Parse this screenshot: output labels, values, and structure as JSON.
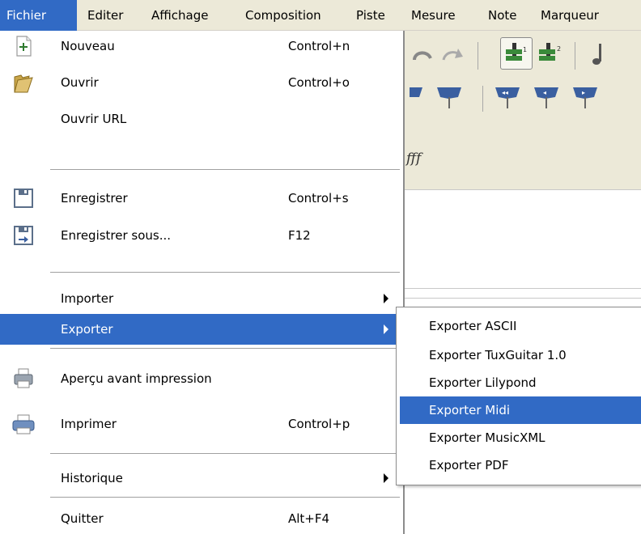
{
  "menubar": {
    "items": [
      {
        "label": "Fichier"
      },
      {
        "label": "Editer"
      },
      {
        "label": "Affichage"
      },
      {
        "label": "Composition"
      },
      {
        "label": "Piste"
      },
      {
        "label": "Mesure"
      },
      {
        "label": "Note"
      },
      {
        "label": "Marqueur"
      }
    ]
  },
  "toolbar": {
    "dynamics_text": "fff"
  },
  "file_menu": {
    "items": [
      {
        "label": "Nouveau",
        "shortcut": "Control+n",
        "icon": "new-file-icon"
      },
      {
        "label": "Ouvrir",
        "shortcut": "Control+o",
        "icon": "folder-open-icon"
      },
      {
        "label": "Ouvrir URL",
        "shortcut": ""
      },
      {
        "label": "Enregistrer",
        "shortcut": "Control+s",
        "icon": "save-icon"
      },
      {
        "label": "Enregistrer sous...",
        "shortcut": "F12",
        "icon": "save-as-icon"
      },
      {
        "label": "Importer",
        "shortcut": "",
        "submenu": true
      },
      {
        "label": "Exporter",
        "shortcut": "",
        "submenu": true,
        "highlighted": true
      },
      {
        "label": "Aperçu avant impression",
        "shortcut": "",
        "icon": "print-preview-icon"
      },
      {
        "label": "Imprimer",
        "shortcut": "Control+p",
        "icon": "printer-icon"
      },
      {
        "label": "Historique",
        "shortcut": "",
        "submenu": true
      },
      {
        "label": "Quitter",
        "shortcut": "Alt+F4"
      }
    ]
  },
  "export_submenu": {
    "items": [
      {
        "label": "Exporter ASCII"
      },
      {
        "label": "Exporter TuxGuitar 1.0"
      },
      {
        "label": "Exporter Lilypond"
      },
      {
        "label": "Exporter Midi",
        "highlighted": true
      },
      {
        "label": "Exporter MusicXML"
      },
      {
        "label": "Exporter PDF"
      }
    ]
  },
  "colors": {
    "highlight": "#316ac5",
    "menubar_bg": "#ece9d8",
    "toolbar_icon_green": "#3a8a3a",
    "toolbar_icon_blue": "#3a5fa0"
  }
}
